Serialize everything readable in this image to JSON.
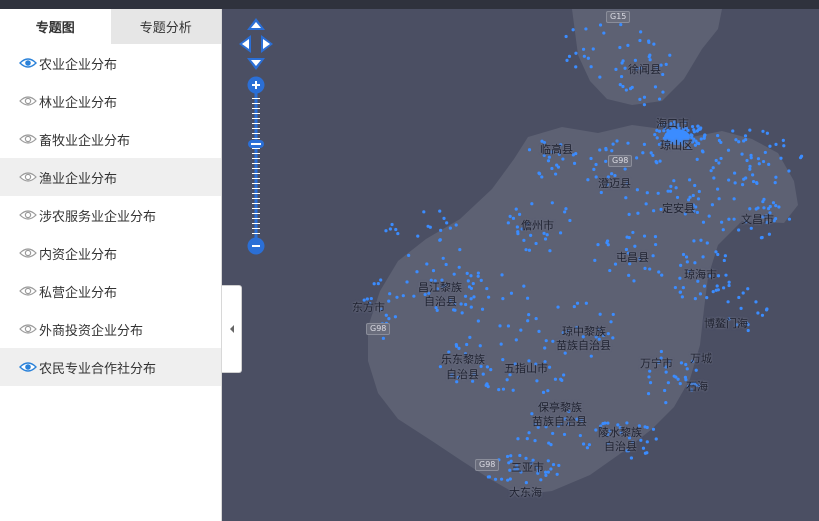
{
  "tabs": [
    {
      "label": "专题图",
      "active": true
    },
    {
      "label": "专题分析",
      "active": false
    }
  ],
  "layers": [
    {
      "label": "农业企业分布",
      "visible": true,
      "highlight": false
    },
    {
      "label": "林业企业分布",
      "visible": false,
      "highlight": false
    },
    {
      "label": "畜牧业企业分布",
      "visible": false,
      "highlight": false
    },
    {
      "label": "渔业企业分布",
      "visible": false,
      "highlight": true
    },
    {
      "label": "涉农服务业企业分布",
      "visible": false,
      "highlight": false
    },
    {
      "label": "内资企业分布",
      "visible": false,
      "highlight": false
    },
    {
      "label": "私营企业分布",
      "visible": false,
      "highlight": false
    },
    {
      "label": "外商投资企业分布",
      "visible": false,
      "highlight": false
    },
    {
      "label": "农民专业合作社分布",
      "visible": true,
      "highlight": true
    }
  ],
  "map": {
    "places": {
      "xuwen": "徐闻县",
      "haikou_1": "海口市",
      "haikou_2": "琼山区",
      "lingao": "临高县",
      "chengmai": "澄迈县",
      "dingan": "定安县",
      "wenchang": "文昌市",
      "danzhou": "儋州市",
      "tunchang": "屯昌县",
      "qionghai": "琼海市",
      "changjiang_1": "昌江黎族",
      "changjiang_2": "自治县",
      "dongfang": "东方市",
      "boao": "博鳌门海",
      "qiongzhong_1": "琼中黎族",
      "qiongzhong_2": "苗族自治县",
      "ledong_1": "乐东黎族",
      "ledong_2": "自治县",
      "wuzhishan": "五指山市",
      "wanning": "万宁市",
      "wanning_town": "万城",
      "shihai": "石海",
      "baoting_1": "保亭黎族",
      "baoting_2": "苗族自治县",
      "lingshui_1": "陵水黎族",
      "lingshui_2": "自治县",
      "sanya": "三亚市",
      "dadonghai": "大东海"
    },
    "shields": {
      "g15": "G15",
      "g98_a": "G98",
      "g98_b": "G98",
      "g98_c": "G98"
    },
    "colors": {
      "land": "#5d6173",
      "sea": "#4b4f63",
      "point": "#3b8cff",
      "control": "#2b6fd6"
    }
  },
  "icons": {
    "eye": "eye-icon",
    "collapse": "chevron-left-icon",
    "pan": "pan-arrows-icon",
    "zoom_in": "plus-icon",
    "zoom_out": "minus-icon"
  }
}
